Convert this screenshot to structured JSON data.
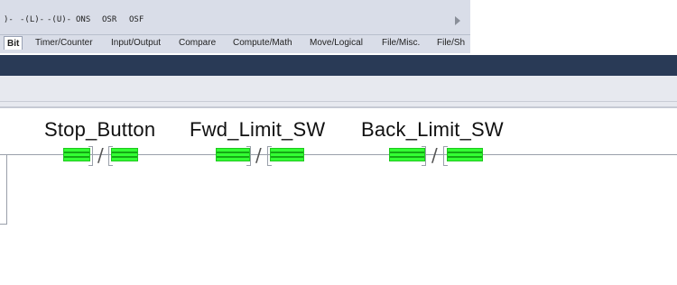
{
  "toolbar": {
    "instructions": [
      ")-",
      "-(L)-",
      "-(U)-",
      "ONS",
      "OSR",
      "OSF"
    ],
    "tabs": [
      "Bit",
      "Timer/Counter",
      "Input/Output",
      "Compare",
      "Compute/Math",
      "Move/Logical",
      "File/Misc.",
      "File/Sh"
    ],
    "active_tab": "Bit"
  },
  "ladder": {
    "contacts": [
      {
        "tag": "Stop_Button",
        "symbol": "/",
        "type": "XIO"
      },
      {
        "tag": "Fwd_Limit_SW",
        "symbol": "/",
        "type": "XIO"
      },
      {
        "tag": "Back_Limit_SW",
        "symbol": "/",
        "type": "XIO"
      }
    ],
    "energized_color": "#33ff33"
  },
  "colors": {
    "band": "#293a56",
    "toolbar_bg": "#d9dde8"
  }
}
